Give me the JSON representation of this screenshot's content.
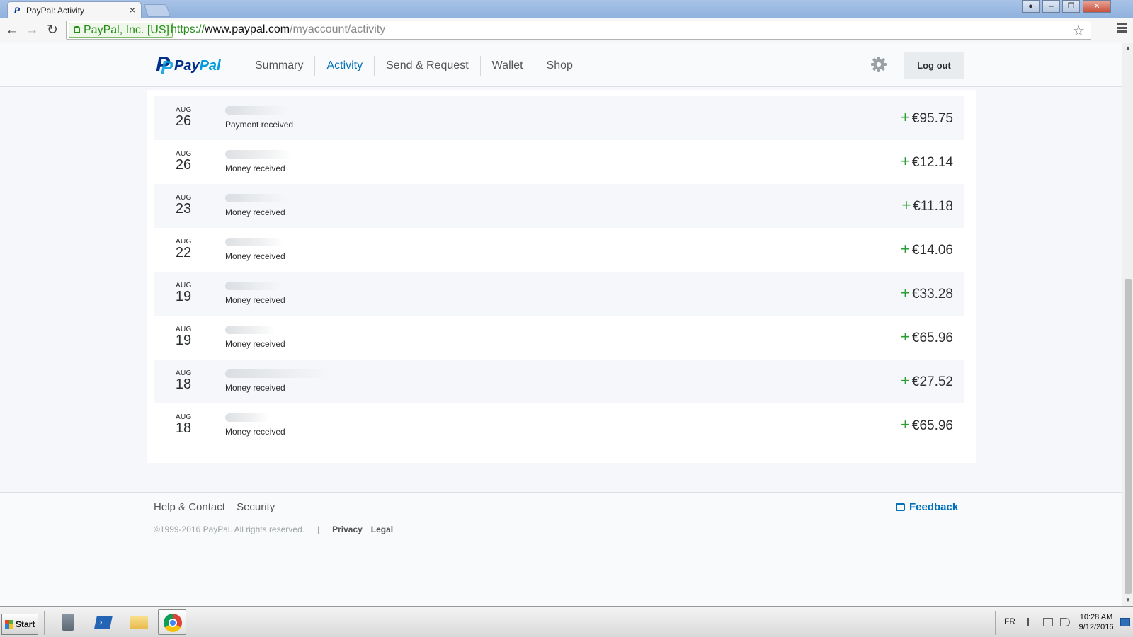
{
  "browser": {
    "tab_title": "PayPal: Activity",
    "tab_close": "×",
    "ev_label": "PayPal, Inc. [US]",
    "url_scheme": "https://",
    "url_host": "www.paypal.com",
    "url_path": "/myaccount/activity",
    "back_icon": "arrow-left-icon",
    "forward_icon": "arrow-right-icon",
    "reload_icon": "reload-icon",
    "bookmark_icon": "star-icon"
  },
  "header": {
    "logo_text_a": "Pay",
    "logo_text_b": "Pal",
    "nav": [
      {
        "label": "Summary",
        "active": false
      },
      {
        "label": "Activity",
        "active": true
      },
      {
        "label": "Send & Request",
        "active": false
      },
      {
        "label": "Wallet",
        "active": false
      },
      {
        "label": "Shop",
        "active": false
      }
    ],
    "logout_label": "Log out"
  },
  "transactions": [
    {
      "month": "AUG",
      "day": "26",
      "description": "Payment received",
      "sign": "+",
      "amount": "€95.75"
    },
    {
      "month": "AUG",
      "day": "26",
      "description": "Money received",
      "sign": "+",
      "amount": "€12.14"
    },
    {
      "month": "AUG",
      "day": "23",
      "description": "Money received",
      "sign": "+",
      "amount": "€11.18"
    },
    {
      "month": "AUG",
      "day": "22",
      "description": "Money received",
      "sign": "+",
      "amount": "€14.06"
    },
    {
      "month": "AUG",
      "day": "19",
      "description": "Money received",
      "sign": "+",
      "amount": "€33.28"
    },
    {
      "month": "AUG",
      "day": "19",
      "description": "Money received",
      "sign": "+",
      "amount": "€65.96"
    },
    {
      "month": "AUG",
      "day": "18",
      "description": "Money received",
      "sign": "+",
      "amount": "€27.52"
    },
    {
      "month": "AUG",
      "day": "18",
      "description": "Money received",
      "sign": "+",
      "amount": "€65.96"
    }
  ],
  "footer": {
    "help_label": "Help & Contact",
    "security_label": "Security",
    "feedback_label": "Feedback",
    "copyright": "©1999-2016 PayPal. All rights reserved.",
    "separator": "|",
    "privacy_label": "Privacy",
    "legal_label": "Legal"
  },
  "taskbar": {
    "start_label": "Start",
    "language": "FR",
    "time": "10:28 AM",
    "date": "9/12/2016",
    "ps_glyph": "›_"
  },
  "colors": {
    "accent": "#0070ba",
    "brand_dark": "#003087",
    "positive": "#2a9e31"
  }
}
